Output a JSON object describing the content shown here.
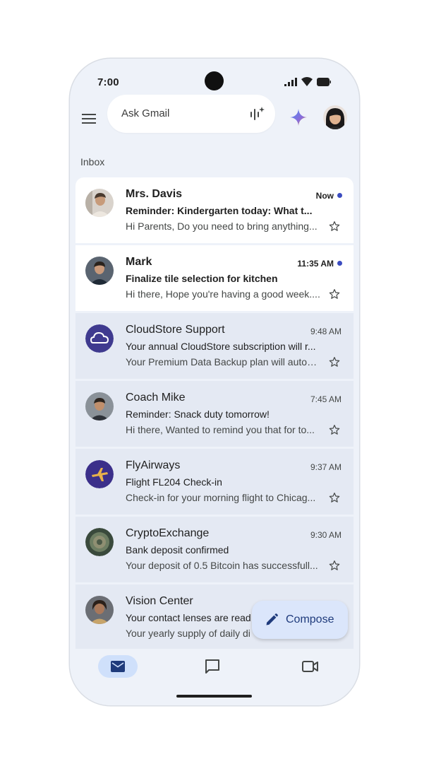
{
  "status_bar": {
    "time": "7:00"
  },
  "search": {
    "placeholder": "Ask Gmail"
  },
  "inbox_label": "Inbox",
  "emails": [
    {
      "sender": "Mrs. Davis",
      "subject": "Reminder: Kindergarten today: What t...",
      "snippet": "Hi Parents, Do you need to bring anything...",
      "time": "Now",
      "unread": true
    },
    {
      "sender": "Mark",
      "subject": "Finalize tile selection for kitchen",
      "snippet": "Hi there, Hope you're having a good week....",
      "time": "11:35 AM",
      "unread": true
    },
    {
      "sender": "CloudStore Support",
      "subject": "Your annual CloudStore subscription will r...",
      "snippet": "Your Premium Data Backup plan will autom...",
      "time": "9:48 AM",
      "unread": false
    },
    {
      "sender": "Coach Mike",
      "subject": "Reminder: Snack duty tomorrow!",
      "snippet": "Hi there, Wanted to remind you that for to...",
      "time": "7:45 AM",
      "unread": false
    },
    {
      "sender": "FlyAirways",
      "subject": "Flight FL204 Check-in",
      "snippet": "Check-in for your morning flight to Chicag...",
      "time": "9:37 AM",
      "unread": false
    },
    {
      "sender": "CryptoExchange",
      "subject": "Bank deposit confirmed",
      "snippet": "Your deposit of 0.5 Bitcoin has successfull...",
      "time": "9:30 AM",
      "unread": false
    },
    {
      "sender": "Vision Center",
      "subject": "Your contact lenses are read",
      "snippet": "Your yearly supply of daily di",
      "time": "",
      "unread": false
    }
  ],
  "compose": {
    "label": "Compose"
  },
  "colors": {
    "accent": "#3b4cc0",
    "background": "#eef2f9",
    "compose_bg": "#dbe6fb",
    "nav_active": "#cfe0fb"
  },
  "icons": [
    "menu-icon",
    "mic-icon",
    "gemini-icon",
    "star-icon",
    "pencil-icon",
    "mail-icon",
    "chat-icon",
    "video-icon"
  ]
}
